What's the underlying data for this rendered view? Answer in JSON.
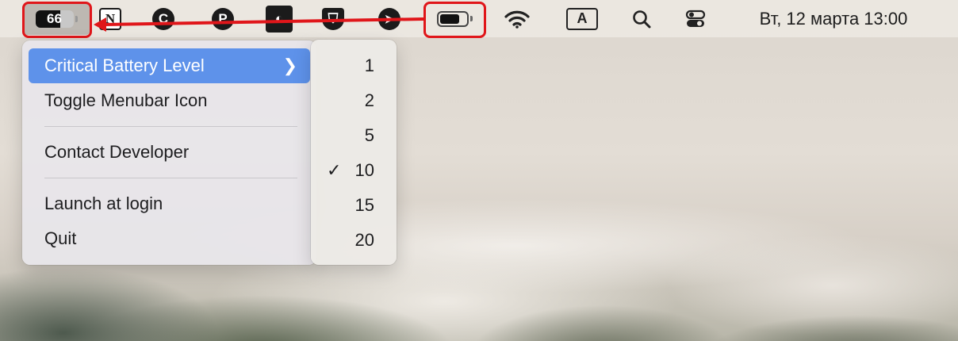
{
  "menubar": {
    "battery_app": {
      "percent_text": "66",
      "fill_fraction": 0.66
    },
    "app_icons": [
      {
        "name": "notion-icon",
        "glyph": "N"
      },
      {
        "name": "c-app-icon",
        "glyph": "C"
      },
      {
        "name": "p-app-icon",
        "glyph": "P"
      },
      {
        "name": "camo-app-icon",
        "glyph": "◐"
      },
      {
        "name": "shield-icon",
        "glyph": "⛉"
      },
      {
        "name": "send-icon",
        "glyph": "➤"
      }
    ],
    "system_battery": {
      "fill_fraction": 0.78
    },
    "keyboard_layout": "A",
    "clock": "Вт, 12 марта  13:00"
  },
  "menu": {
    "items": [
      {
        "label": "Critical Battery Level",
        "has_submenu": true,
        "active": true
      },
      {
        "label": "Toggle Menubar Icon"
      },
      {
        "label": "Contact Developer"
      },
      {
        "label": "Launch at login"
      },
      {
        "label": "Quit"
      }
    ]
  },
  "submenu": {
    "options": [
      {
        "label": "1",
        "checked": false
      },
      {
        "label": "2",
        "checked": false
      },
      {
        "label": "5",
        "checked": false
      },
      {
        "label": "10",
        "checked": true
      },
      {
        "label": "15",
        "checked": false
      },
      {
        "label": "20",
        "checked": false
      }
    ],
    "check_glyph": "✓"
  },
  "colors": {
    "highlight": "#e0161a",
    "menu_selection": "#5e92ea"
  }
}
